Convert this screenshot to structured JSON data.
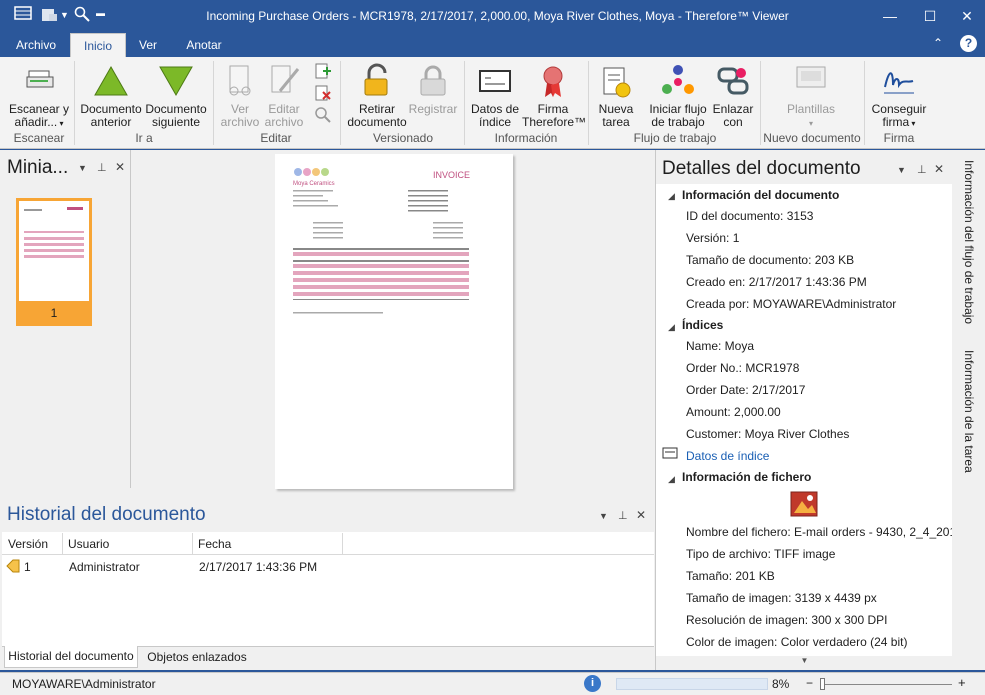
{
  "window": {
    "title": "Incoming Purchase Orders - MCR1978, 2/17/2017, 2,000.00, Moya River Clothes, Moya - Therefore™ Viewer"
  },
  "ribbon_tabs": [
    "Archivo",
    "Inicio",
    "Ver",
    "Anotar"
  ],
  "ribbon": {
    "scan": "Escanear y añadir...",
    "prev_doc": "Documento anterior",
    "next_doc": "Documento siguiente",
    "view_file": "Ver archivo",
    "edit_file": "Editar archivo",
    "checkout": "Retirar documento",
    "checkin": "Registrar",
    "index_data": "Datos de índice",
    "signature": "Firma Therefore™",
    "new_task": "Nueva tarea",
    "start_workflow": "Iniciar flujo de trabajo",
    "link_with": "Enlazar con",
    "templates": "Plantillas",
    "get_signature": "Conseguir firma",
    "groups": {
      "scan": "Escanear",
      "goto": "Ir a",
      "edit": "Editar",
      "version": "Versionado",
      "info": "Información",
      "workflow": "Flujo de trabajo",
      "new_doc": "Nuevo documento",
      "sign": "Firma"
    }
  },
  "thumbnails": {
    "title": "Minia...",
    "page_number": "1"
  },
  "invoice_preview": {
    "company": "Moya Ceramics",
    "heading": "INVOICE"
  },
  "history": {
    "title": "Historial del documento",
    "columns": [
      "Versión",
      "Usuario",
      "Fecha"
    ],
    "rows": [
      {
        "version": "1",
        "user": "Administrator",
        "date": "2/17/2017 1:43:36 PM"
      }
    ],
    "tabs": [
      "Historial del documento",
      "Objetos enlazados"
    ]
  },
  "details": {
    "title": "Detalles del documento",
    "doc_info_header": "Información del documento",
    "doc_id": "ID del documento: 3153",
    "version": "Versión: 1",
    "doc_size": "Tamaño de documento: 203 KB",
    "created_on": "Creado en: 2/17/2017 1:43:36 PM",
    "created_by": "Creada por: MOYAWARE\\Administrator",
    "indices_header": "Índices",
    "name": "Name:  Moya",
    "order_no": "Order No.:  MCR1978",
    "order_date": "Order Date:  2/17/2017",
    "amount": "Amount:  2,000.00",
    "customer": "Customer:  Moya River Clothes",
    "index_link": "Datos de índice",
    "file_info_header": "Información de fichero",
    "file_name": "Nombre del fichero: E-mail orders - 9430, 2_4_201...",
    "file_type": "Tipo de archivo: TIFF image",
    "file_size": "Tamaño: 201 KB",
    "image_size": "Tamaño de imagen:  3139 x 4439 px",
    "resolution": "Resolución de imagen:  300 x 300 DPI",
    "color": "Color de imagen:  Color verdadero (24 bit)"
  },
  "side_tabs": [
    "Información del flujo de trabajo",
    "Información de la tarea"
  ],
  "status": {
    "user": "MOYAWARE\\Administrator",
    "zoom": "8%"
  },
  "colors": {
    "accent": "#2b579a",
    "thumb_selected": "#f7a535",
    "link": "#1a5fb4"
  }
}
